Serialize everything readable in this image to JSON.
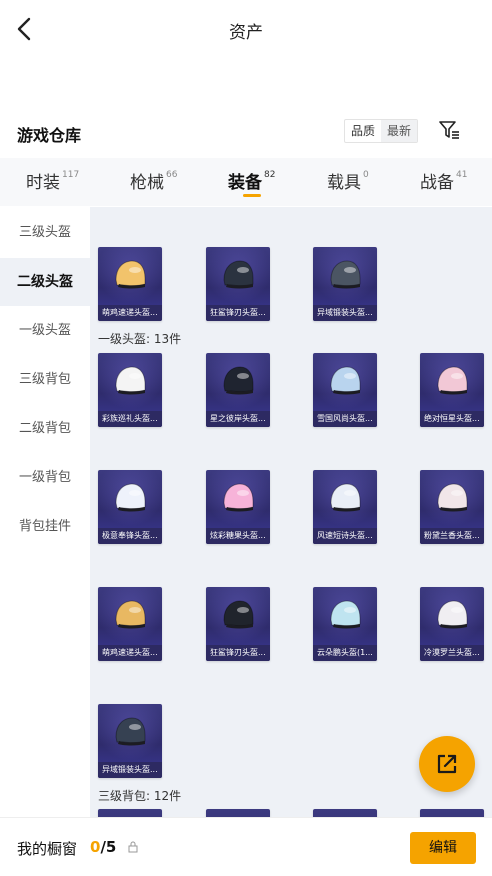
{
  "header": {
    "title": "资产",
    "back_icon": "chevron-left-icon"
  },
  "warehouse": {
    "title": "游戏仓库",
    "sort_options": [
      "品质",
      "最新"
    ],
    "filter_icon": "filter-list-icon"
  },
  "tabs": [
    {
      "label": "时装",
      "count": "117"
    },
    {
      "label": "枪械",
      "count": "66"
    },
    {
      "label": "装备",
      "count": "82",
      "active": true
    },
    {
      "label": "载具",
      "count": "0"
    },
    {
      "label": "战备",
      "count": "41"
    }
  ],
  "sidebar": [
    "三级头盔",
    "二级头盔",
    "一级头盔",
    "三级背包",
    "二级背包",
    "一级背包",
    "背包挂件"
  ],
  "sidebar_active": "二级头盔",
  "sections": [
    {
      "items": [
        "萌鸡速递头盔...",
        "狂鲨锋刃头盔...",
        "异域锻装头盔..."
      ]
    },
    {
      "label": "一级头盔: 13件",
      "items": [
        "彩族巡礼头盔...",
        "星之彼岸头盔...",
        "雪国风尚头盔...",
        "绝对恒星头盔...",
        "极意奉锋头盔...",
        "炫彩糖果头盔...",
        "风速短诗头盔...",
        "粉黛兰香头盔...",
        "萌鸡速递头盔...",
        "狂鲨锋刃头盔...",
        "云朵鹏头盔(1...",
        "冷漠罗兰头盔...",
        "异域锻装头盔..."
      ]
    },
    {
      "label": "三级背包: 12件"
    }
  ],
  "showcase": {
    "label": "我的橱窗",
    "current": "0",
    "total": "/5"
  },
  "edit_button": "编辑",
  "colors": {
    "accent": "#f5a300",
    "card_bg": "#35327a",
    "grid_bg": "#eef1f6"
  }
}
